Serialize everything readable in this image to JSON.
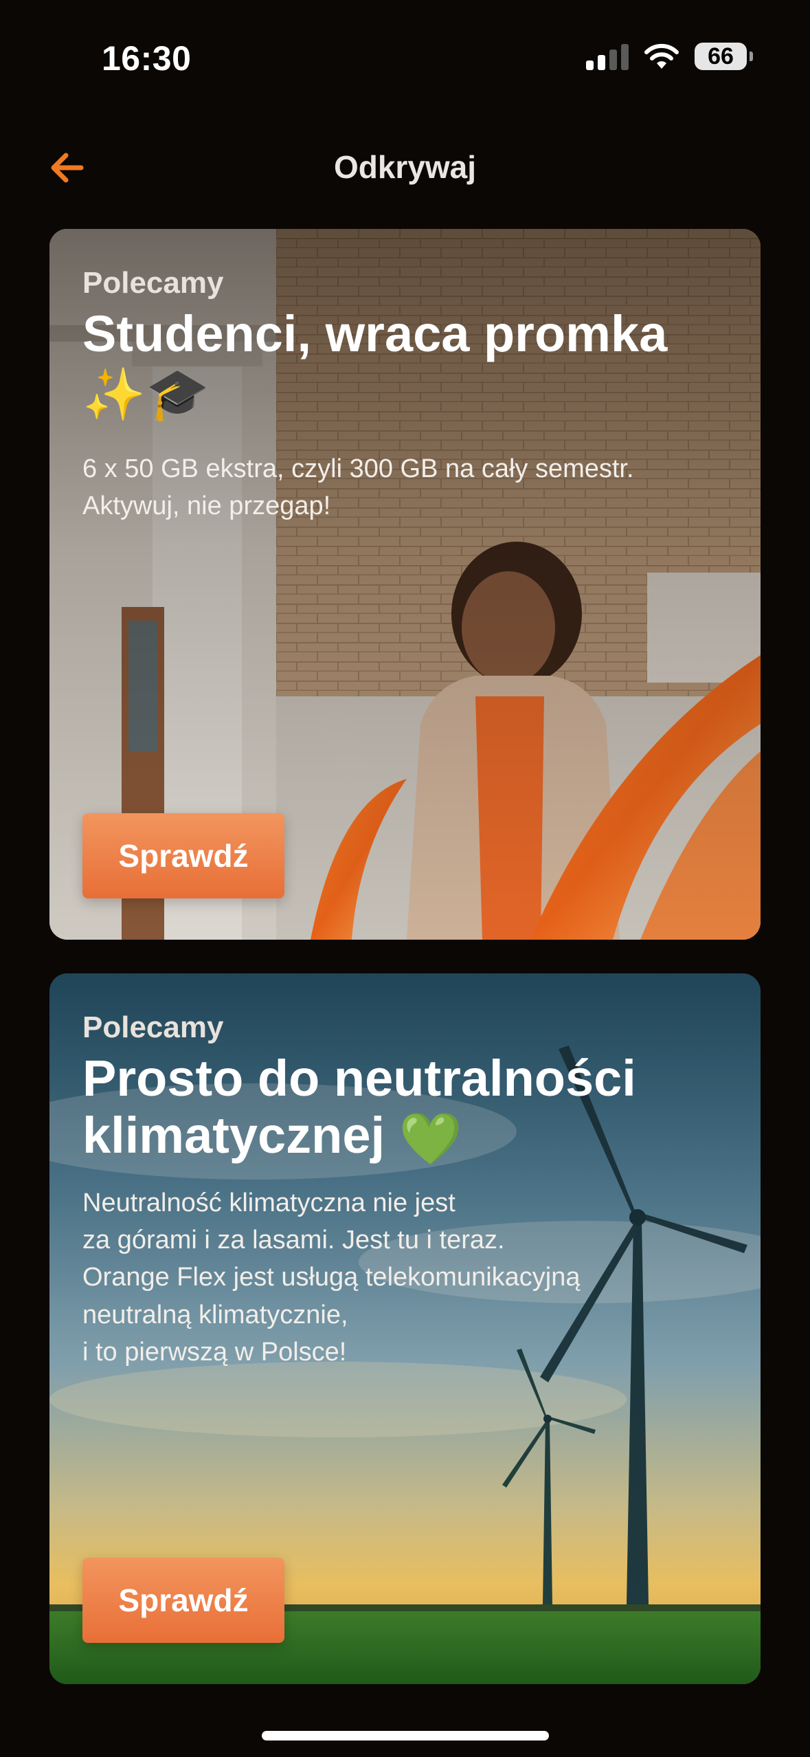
{
  "status_bar": {
    "time": "16:30",
    "battery": "66",
    "signal_icon": "cellular-signal-icon",
    "wifi_icon": "wifi-icon"
  },
  "header": {
    "title": "Odkrywaj",
    "back_icon": "arrow-left-icon",
    "accent_color": "#f07a22"
  },
  "cards": [
    {
      "eyebrow": "Polecamy",
      "title": "Studenci, wraca promka",
      "title_emoji": "✨🎓",
      "description": "6 x 50 GB ekstra, czyli 300 GB na cały semestr.\nAktywuj, nie przegap!",
      "button_label": "Sprawdź"
    },
    {
      "eyebrow": "Polecamy",
      "title": "Prosto do neutralności klimatycznej",
      "title_emoji": "💚",
      "description": "Neutralność klimatyczna nie jest\nza górami i za lasami. Jest tu i teraz.\nOrange Flex jest usługą telekomunikacyjną\nneutralną klimatycznie,\ni to pierwszą w Polsce!",
      "button_label": "Sprawdź"
    }
  ],
  "colors": {
    "background": "#0b0705",
    "button_gradient_top": "#f2955e",
    "button_gradient_bottom": "#e86f37"
  }
}
